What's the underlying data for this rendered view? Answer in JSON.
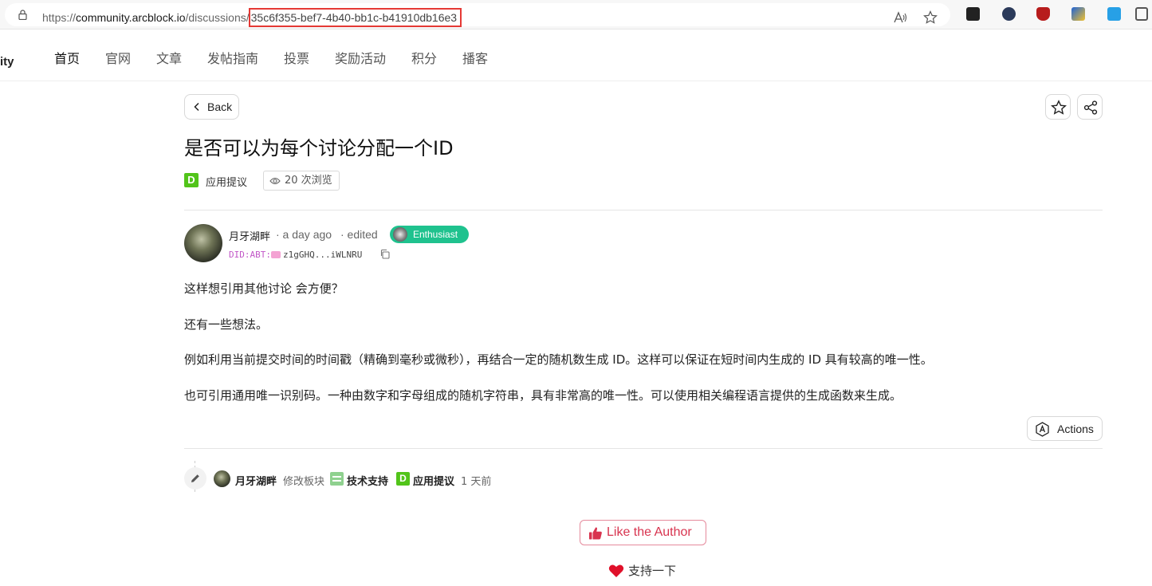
{
  "browser": {
    "url_prefix": "https://",
    "url_host": "community.arcblock.io",
    "url_path": "/discussions/",
    "url_id": "35c6f355-bef7-4b40-bb1c-b41910db16e3"
  },
  "site": {
    "brand_fragment": "ity",
    "nav": [
      "首页",
      "官网",
      "文章",
      "发帖指南",
      "投票",
      "奖励活动",
      "积分",
      "播客"
    ]
  },
  "post": {
    "back_label": "Back",
    "title": "是否可以为每个讨论分配一个ID",
    "board_tag_letter": "D",
    "board": "应用提议",
    "views": "20 次浏览",
    "author": "月牙湖畔",
    "time_ago": "· a day ago",
    "edited": "· edited",
    "badge": "Enthusiast",
    "did_prefix": "DID:ABT:",
    "did_value": "z1gGHQ...iWLNRU",
    "paragraphs": [
      "这样想引用其他讨论 会方便？",
      "还有一些想法。",
      "例如利用当前提交时间的时间戳（精确到毫秒或微秒），再结合一定的随机数生成 ID。这样可以保证在短时间内生成的 ID 具有较高的唯一性。",
      "也可引用通用唯一识别码。一种由数字和字母组成的随机字符串，具有非常高的唯一性。可以使用相关编程语言提供的生成函数来生成。"
    ],
    "actions_label": "Actions"
  },
  "activity": {
    "user": "月牙湖畔",
    "action": "修改板块",
    "from_board": "技术支持",
    "to_tag_letter": "D",
    "to_board": "应用提议",
    "time": "1 天前"
  },
  "footer": {
    "like_label": "Like the Author",
    "support_label": "支持一下"
  },
  "colors": {
    "accent_green": "#52c41a",
    "badge_green": "#1fc28e",
    "like_red": "#d8344f",
    "highlight_red": "#e53935"
  }
}
